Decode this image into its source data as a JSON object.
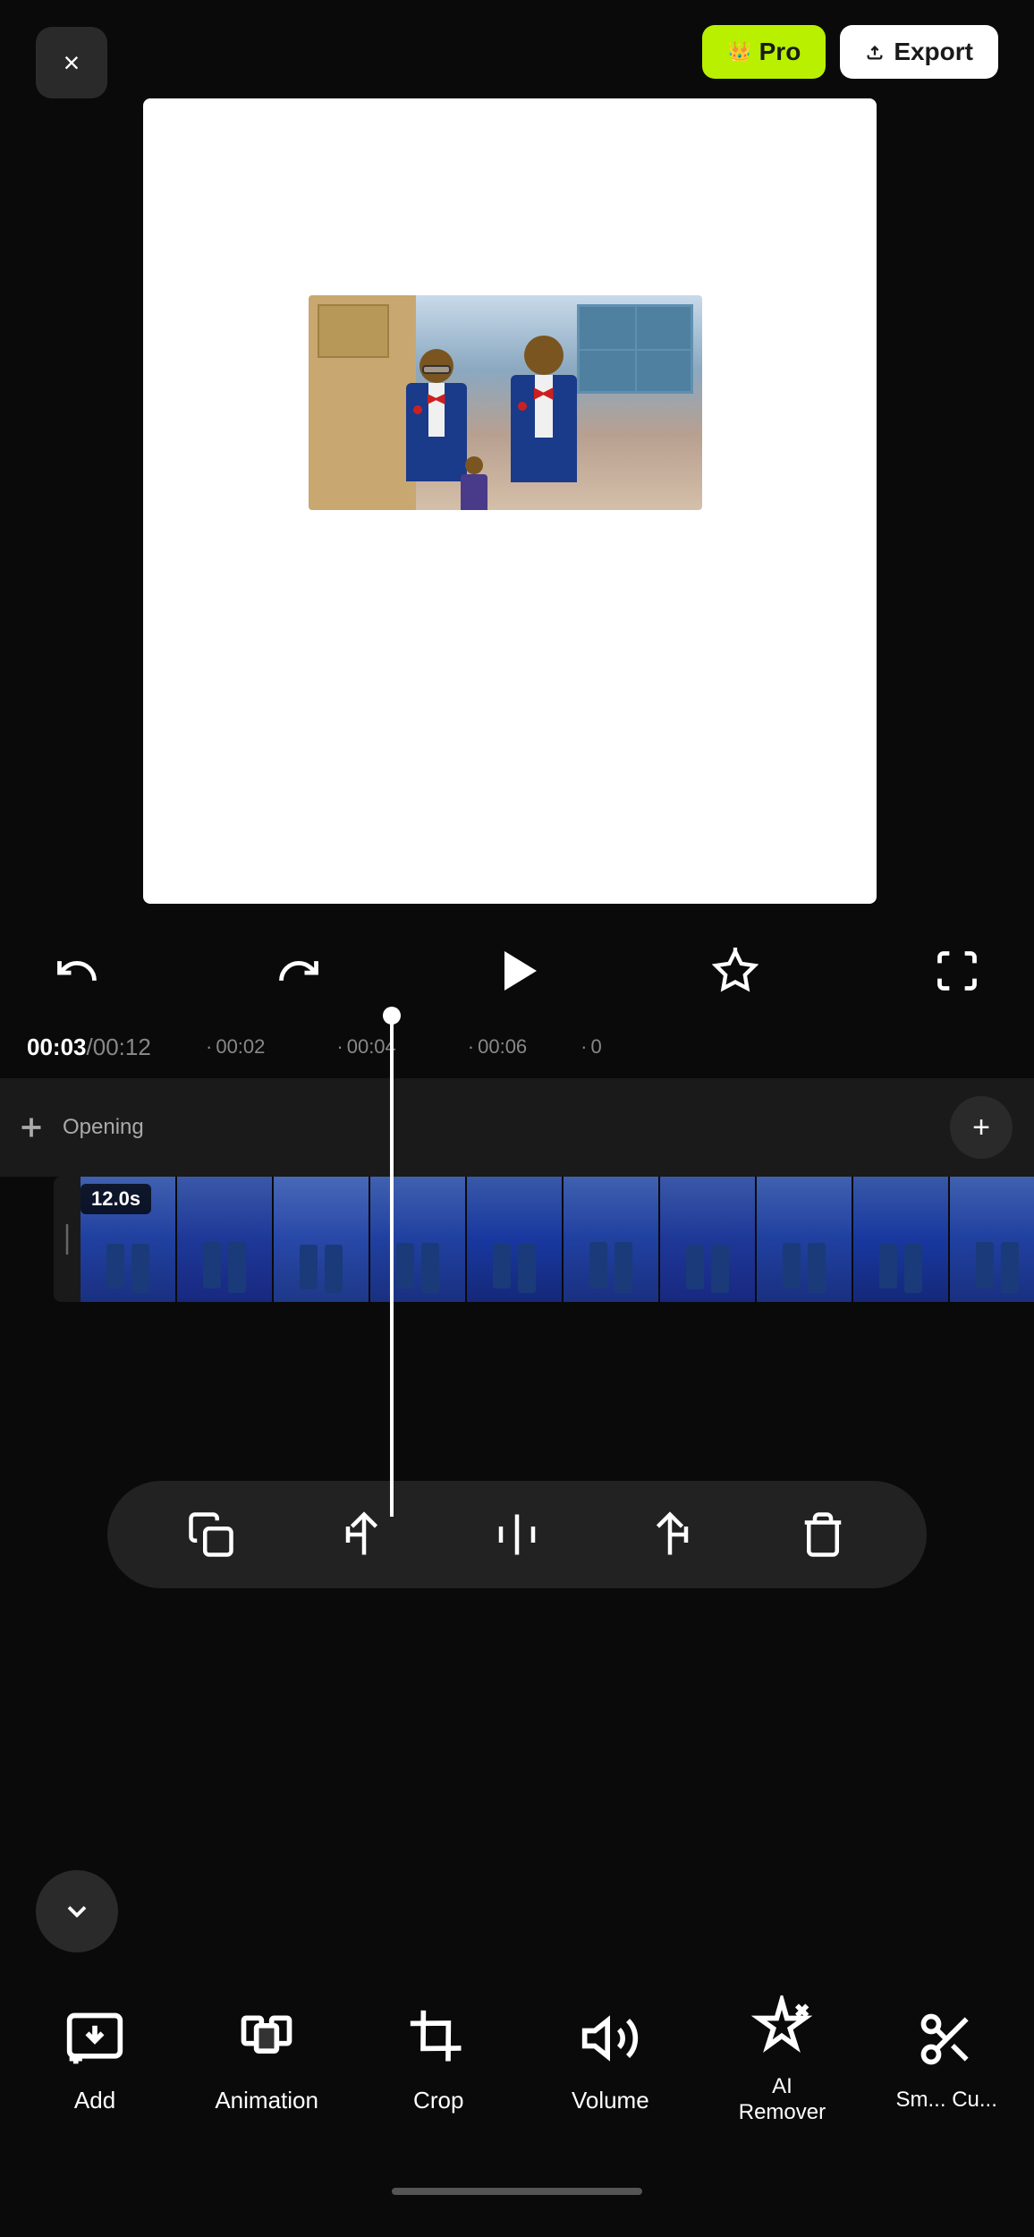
{
  "header": {
    "close_label": "×",
    "pro_label": "Pro",
    "export_label": "Export",
    "crown_symbol": "👑"
  },
  "timeline": {
    "current_time": "00:03",
    "total_time": "00:12",
    "time_display": "00:03/00:12",
    "markers": [
      "00:02",
      "00:04",
      "00:06"
    ],
    "duration_badge": "12.0s"
  },
  "controls": {
    "undo_label": "undo",
    "redo_label": "redo",
    "play_label": "play",
    "effects_label": "effects",
    "fullscreen_label": "fullscreen"
  },
  "track_area": {
    "add_label": "+",
    "opening_label": "Opening",
    "plus_circle_label": "+"
  },
  "timeline_tools": {
    "copy_label": "copy",
    "split_left_label": "split-left",
    "split_label": "split",
    "split_right_label": "split-right",
    "delete_label": "delete"
  },
  "bottom_toolbar": {
    "items": [
      {
        "id": "add",
        "label": "Add",
        "icon": "add-icon"
      },
      {
        "id": "animation",
        "label": "Animation",
        "icon": "animation-icon"
      },
      {
        "id": "crop",
        "label": "Crop",
        "icon": "crop-icon"
      },
      {
        "id": "volume",
        "label": "Volume",
        "icon": "volume-icon"
      },
      {
        "id": "ai-remover",
        "label": "AI\nRemover",
        "icon": "ai-icon"
      },
      {
        "id": "smart-cut",
        "label": "Sm... Cu...",
        "icon": "cut-icon"
      }
    ]
  },
  "colors": {
    "background": "#0a0a0a",
    "pro_green": "#b8f000",
    "white": "#ffffff",
    "accent": "#4a90e2",
    "track_bg": "#2a2a2a"
  }
}
